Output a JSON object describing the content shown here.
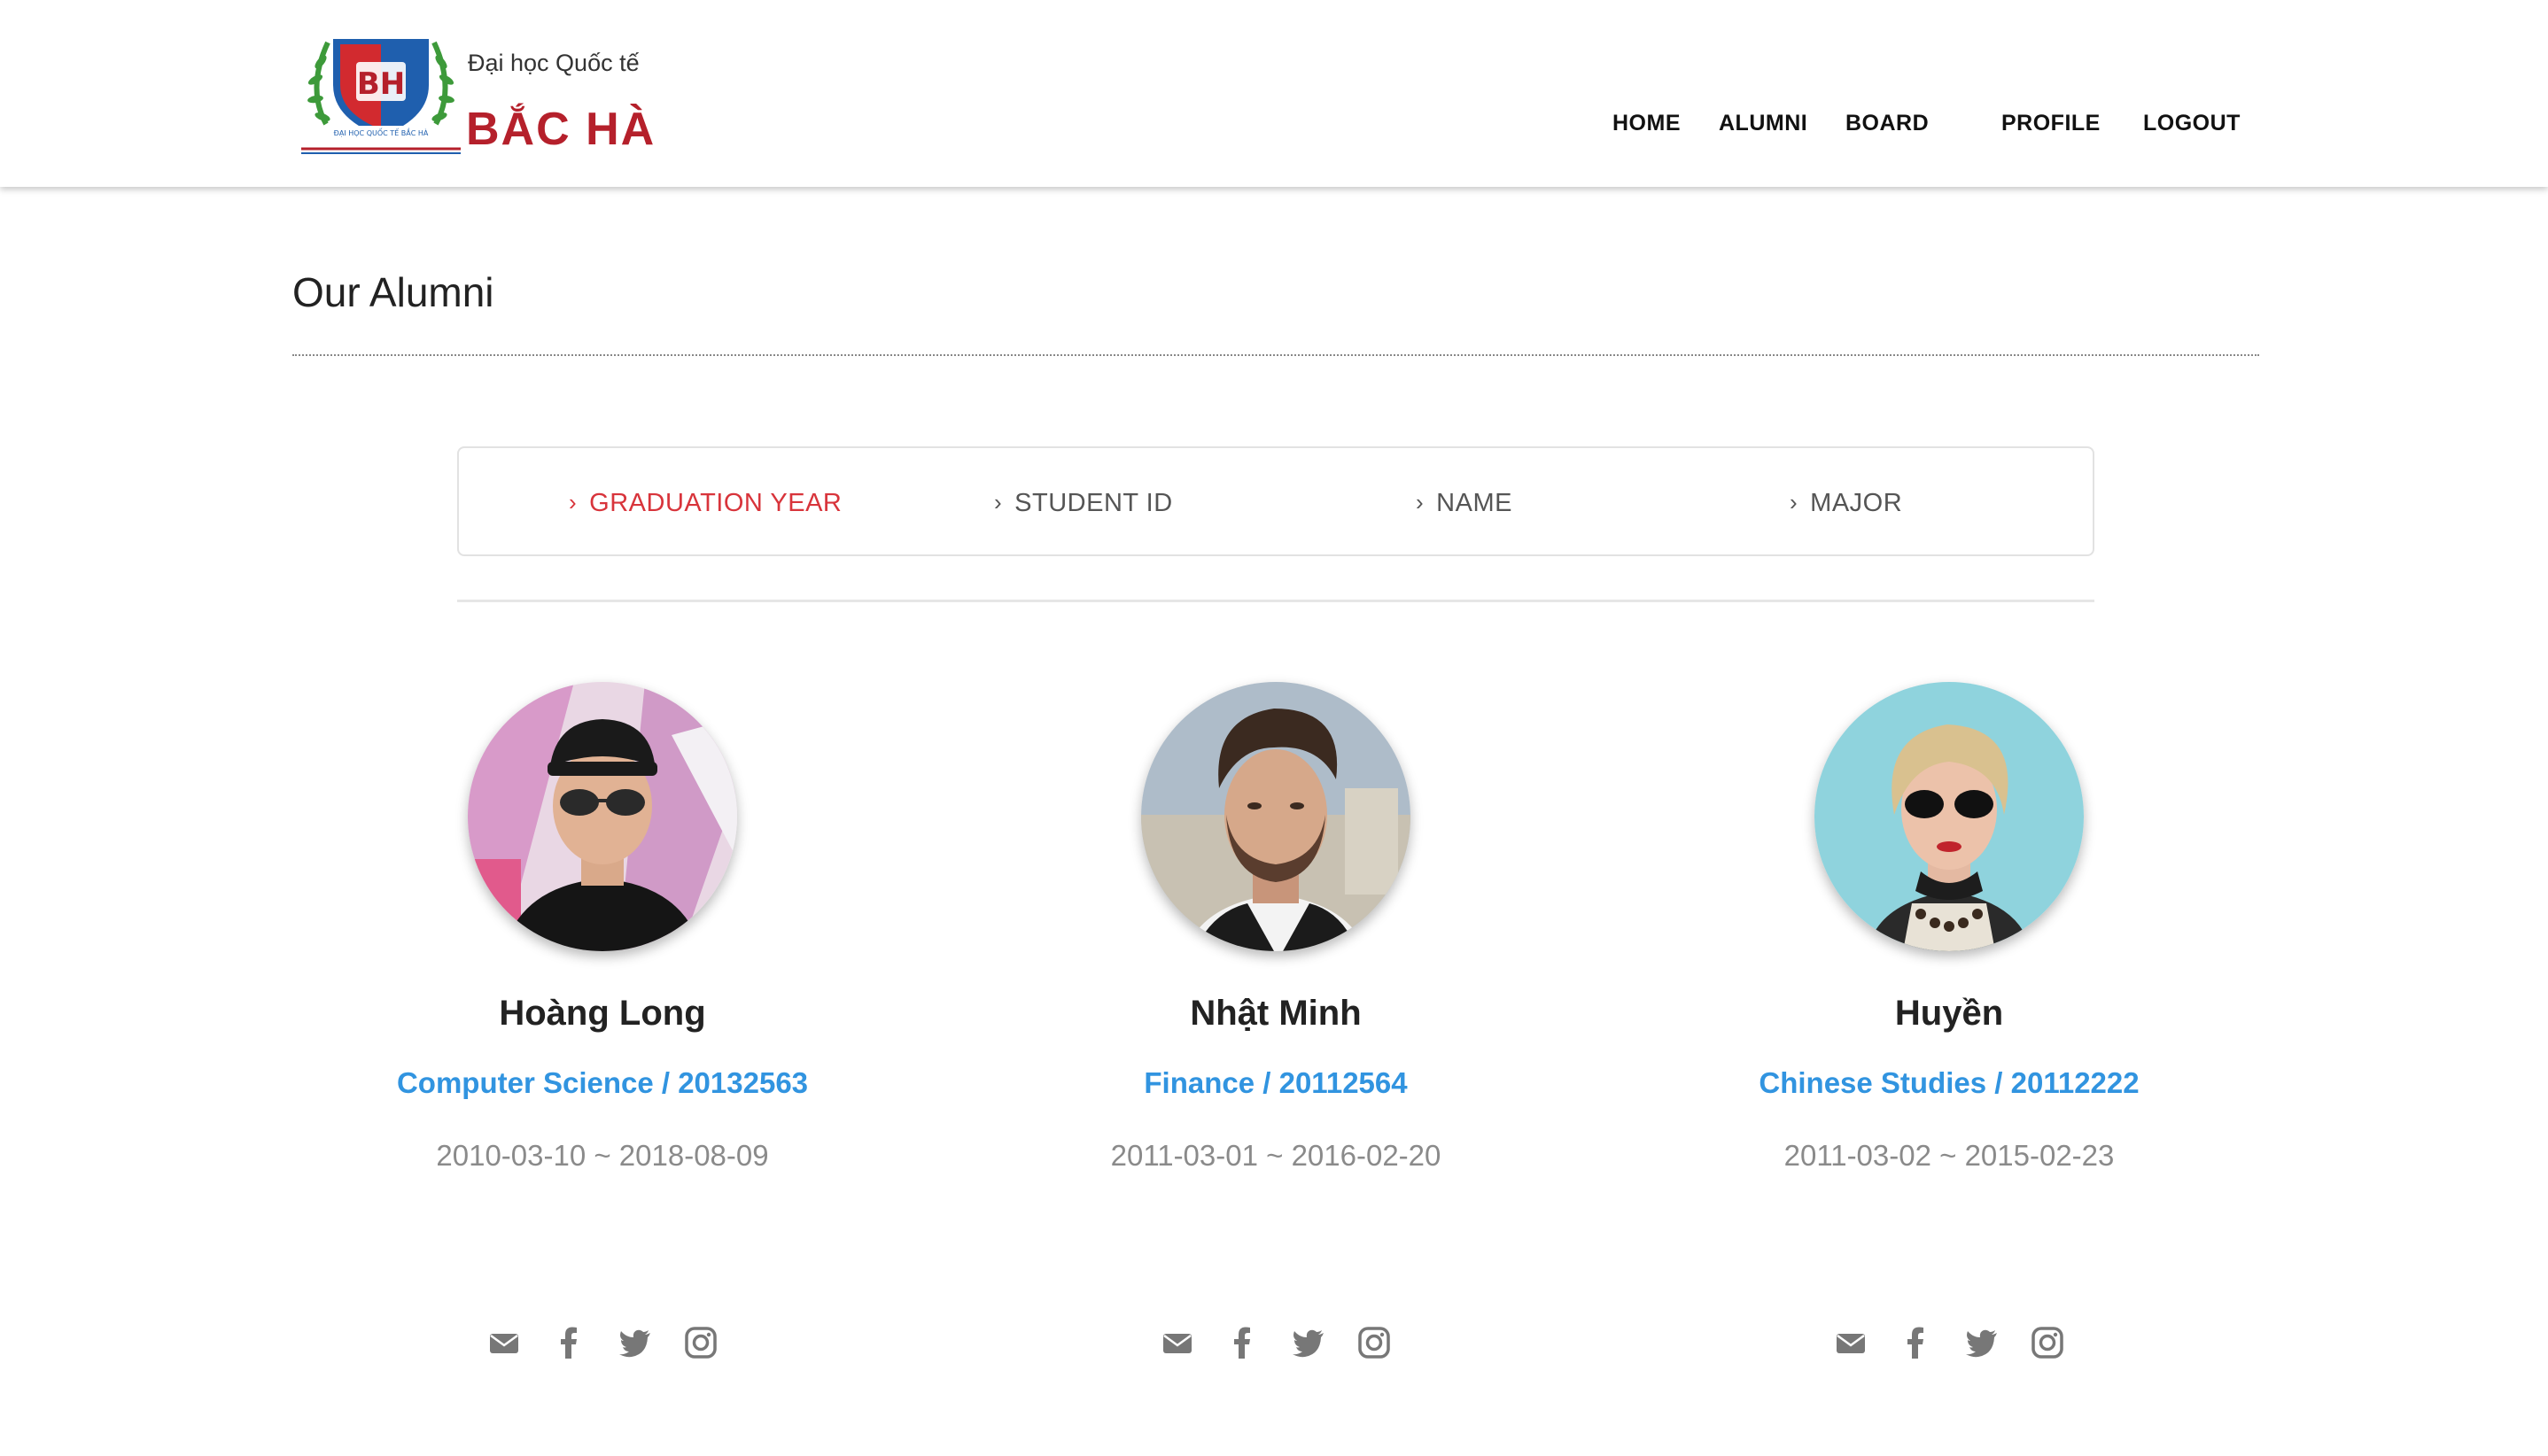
{
  "brand": {
    "line1": "Đại học Quốc tế",
    "line2": "BẮC HÀ",
    "emblem_text": "BH",
    "emblem_caption": "ĐẠI HỌC QUỐC TẾ BẮC HÀ",
    "colors": {
      "red": "#b5202b",
      "blue": "#1f5fae",
      "green": "#3d9a3a"
    }
  },
  "nav": {
    "items": [
      {
        "label": "HOME"
      },
      {
        "label": "ALUMNI"
      },
      {
        "label": "BOARD"
      },
      {
        "label": "PROFILE"
      },
      {
        "label": "LOGOUT"
      }
    ]
  },
  "page": {
    "title": "Our Alumni"
  },
  "filters": {
    "items": [
      {
        "label": "GRADUATION YEAR",
        "active": true
      },
      {
        "label": "STUDENT ID",
        "active": false
      },
      {
        "label": "NAME",
        "active": false
      },
      {
        "label": "MAJOR",
        "active": false
      }
    ],
    "chevron": "›",
    "active_color": "#d8343b"
  },
  "alumni": [
    {
      "name": "Hoàng Long",
      "major_id": "Computer Science / 20132563",
      "dates": "2010-03-10 ~ 2018-08-09"
    },
    {
      "name": "Nhật Minh",
      "major_id": "Finance / 20112564",
      "dates": "2011-03-01 ~ 2016-02-20"
    },
    {
      "name": "Huyền",
      "major_id": "Chinese Studies / 20112222",
      "dates": "2011-03-02 ~ 2015-02-23"
    }
  ],
  "social_icons": [
    "envelope-icon",
    "facebook-icon",
    "twitter-icon",
    "instagram-icon"
  ],
  "colors": {
    "link_blue": "#3194e0",
    "muted_gray": "#8a8a8a",
    "icon_gray": "#777777"
  }
}
